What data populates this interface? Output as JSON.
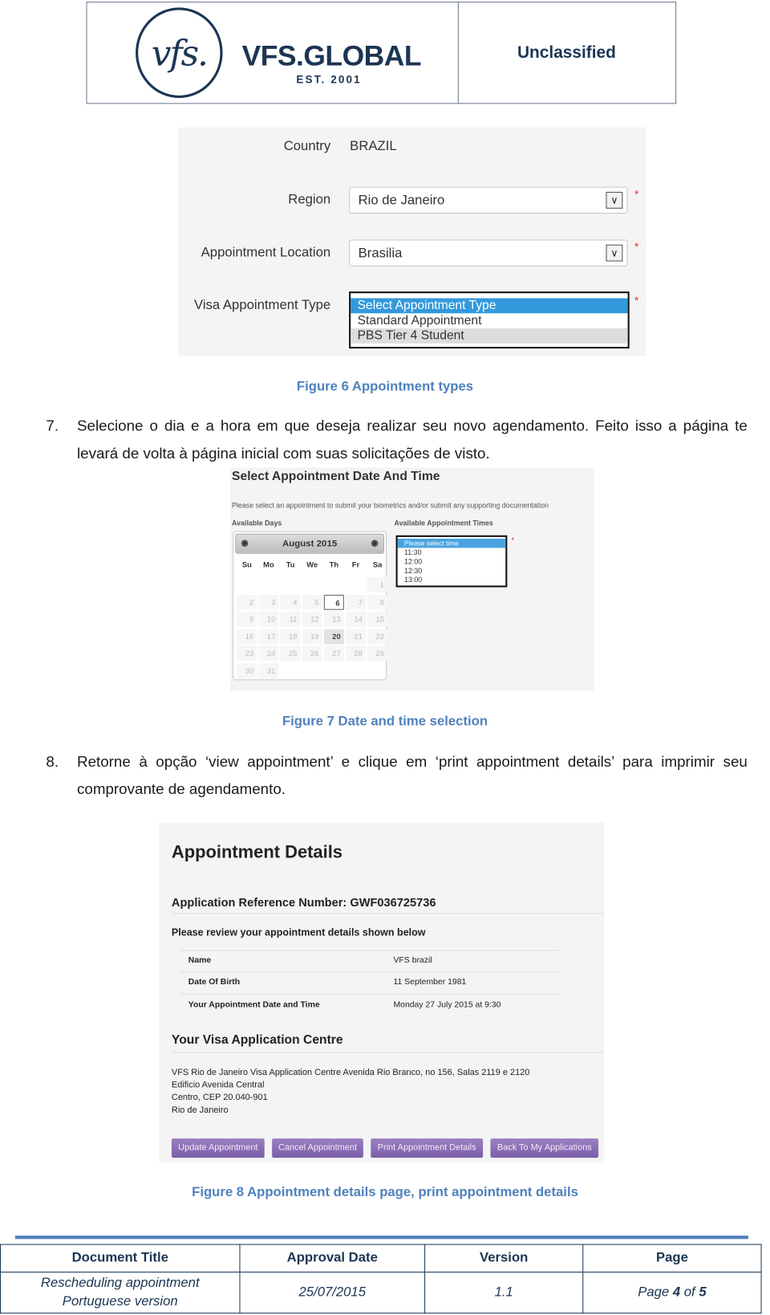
{
  "header": {
    "logo_mark": "vfs.",
    "logo_name": "VFS.GLOBAL",
    "logo_est": "EST. 2001",
    "classification": "Unclassified"
  },
  "figure6": {
    "fields": [
      {
        "label": "Country",
        "value": "BRAZIL"
      },
      {
        "label": "Region",
        "value": "Rio de Janeiro"
      },
      {
        "label": "Appointment Location",
        "value": "Brasilia"
      },
      {
        "label": "Visa Appointment Type",
        "options": [
          "Select Appointment Type",
          "Standard Appointment",
          "PBS Tier 4 Student"
        ]
      }
    ],
    "required_mark": "*",
    "caption": "Figure 6 Appointment types"
  },
  "step7": {
    "number": "7.",
    "text": "Selecione o dia e a hora em que deseja realizar seu novo agendamento. Feito isso a página te levará de volta à página inicial com suas solicitações de visto."
  },
  "figure7": {
    "title": "Select Appointment Date And Time",
    "instruction": "Please select an appointment to submit your biometrics and/or submit any supporting documentation",
    "days_label": "Available Days",
    "times_label": "Available Appointment Times",
    "month": "August 2015",
    "weekdays": [
      "Su",
      "Mo",
      "Tu",
      "We",
      "Th",
      "Fr",
      "Sa"
    ],
    "available_days": [
      6
    ],
    "highlighted_day": 20,
    "times": [
      "Please select time",
      "11:30",
      "12:00",
      "12:30",
      "13:00"
    ],
    "caption": "Figure 7 Date and time selection"
  },
  "step8": {
    "number": "8.",
    "text": "Retorne à opção ‘view appointment’ e clique em ‘print appointment details’ para imprimir seu comprovante de agendamento."
  },
  "figure8": {
    "title": "Appointment Details",
    "reference": "Application Reference Number: GWF036725736",
    "review": "Please review your appointment details shown below",
    "rows": [
      {
        "label": "Name",
        "value": "VFS  brazil"
      },
      {
        "label": "Date Of Birth",
        "value": "11 September 1981"
      },
      {
        "label": "Your Appointment Date and Time",
        "value": "Monday 27 July 2015  at  9:30"
      }
    ],
    "centre_title": "Your Visa Application Centre",
    "address": [
      "VFS Rio de Janeiro Visa Application Centre Avenida Rio Branco, no 156, Salas 2119 e 2120",
      "Edificio Avenida Central",
      "Centro, CEP 20.040-901",
      "Rio de Janeiro"
    ],
    "buttons": [
      "Update Appointment",
      "Cancel Appointment",
      "Print Appointment Details",
      "Back To My Applications"
    ],
    "caption": "Figure 8 Appointment details page, print appointment details"
  },
  "footer": {
    "headers": [
      "Document Title",
      "Approval Date",
      "Version",
      "Page"
    ],
    "title_line1": "Rescheduling appointment",
    "title_line2": "Portuguese version",
    "approval_date": "25/07/2015",
    "version": "1.1",
    "page_prefix": "Page ",
    "page_current": "4",
    "page_of": " of ",
    "page_total": "5"
  },
  "colors": {
    "accent": "#4f81bd",
    "brand": "#1c3553",
    "button": "#8a6bb5",
    "selection": "#3399dd"
  }
}
